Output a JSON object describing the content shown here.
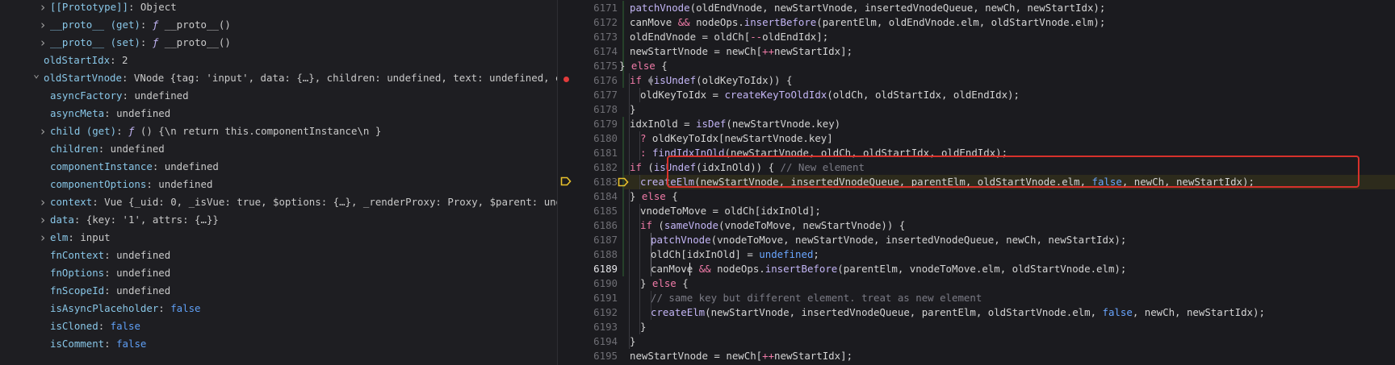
{
  "scope_panel": {
    "rows": [
      {
        "twisty": "right",
        "key": "[[Prototype]]",
        "sep": ": ",
        "value": "Object"
      },
      {
        "twisty": "right",
        "key": "__proto__ (get)",
        "sep": ": ",
        "value_f": "ƒ",
        "value": "__proto__()"
      },
      {
        "twisty": "right",
        "key": "__proto__ (set)",
        "sep": ": ",
        "value_f": "ƒ",
        "value": "__proto__()"
      },
      {
        "twisty": "none",
        "key": "oldStartIdx",
        "sep": ": ",
        "value": "2"
      },
      {
        "twisty": "down",
        "key": "oldStartVnode",
        "sep": ": ",
        "value": "VNode {tag: 'input', data: {…}, children: undefined, text: undefined, elm: input…"
      },
      {
        "twisty": "none",
        "key": "asyncFactory",
        "sep": ": ",
        "value": "undefined"
      },
      {
        "twisty": "none",
        "key": "asyncMeta",
        "sep": ": ",
        "value": "undefined"
      },
      {
        "twisty": "right",
        "key": "child (get)",
        "sep": ": ",
        "value_f": "ƒ",
        "value": "() {\\n    return this.componentInstance\\n  }"
      },
      {
        "twisty": "none",
        "key": "children",
        "sep": ": ",
        "value": "undefined"
      },
      {
        "twisty": "none",
        "key": "componentInstance",
        "sep": ": ",
        "value": "undefined"
      },
      {
        "twisty": "none",
        "key": "componentOptions",
        "sep": ": ",
        "value": "undefined"
      },
      {
        "twisty": "right",
        "key": "context",
        "sep": ": ",
        "value": "Vue {_uid: 0, _isVue: true, $options: {…}, _renderProxy: Proxy, $parent: undefined, …"
      },
      {
        "twisty": "right",
        "key": "data",
        "sep": ": ",
        "value": "{key: '1', attrs: {…}}"
      },
      {
        "twisty": "right",
        "key": "elm",
        "sep": ": ",
        "value": "input"
      },
      {
        "twisty": "none",
        "key": "fnContext",
        "sep": ": ",
        "value": "undefined"
      },
      {
        "twisty": "none",
        "key": "fnOptions",
        "sep": ": ",
        "value": "undefined"
      },
      {
        "twisty": "none",
        "key": "fnScopeId",
        "sep": ": ",
        "value": "undefined"
      },
      {
        "twisty": "none",
        "key": "isAsyncPlaceholder",
        "sep": ": ",
        "value": "false"
      },
      {
        "twisty": "none",
        "key": "isCloned",
        "sep": ": ",
        "value": "false"
      },
      {
        "twisty": "none",
        "key": "isComment",
        "sep": ": ",
        "value": "false"
      }
    ]
  },
  "editor": {
    "current_line": "6189",
    "line_numbers": [
      "6171",
      "6172",
      "6173",
      "6174",
      "6175",
      "6176",
      "6177",
      "6178",
      "6179",
      "6180",
      "6181",
      "6182",
      "6183",
      "6184",
      "6185",
      "6186",
      "6187",
      "6188",
      "6189",
      "6190",
      "6191",
      "6192",
      "6193",
      "6194",
      "6195"
    ],
    "lines": [
      "patchVnode(oldEndVnode, newStartVnode, insertedVnodeQueue, newCh, newStartIdx);",
      "canMove && nodeOps.insertBefore(parentElm, oldEndVnode.elm, oldStartVnode.elm);",
      "oldEndVnode = oldCh[--oldEndIdx];",
      "newStartVnode = newCh[++newStartIdx];",
      "} else {",
      "if (isUndef(oldKeyToIdx)) {",
      "oldKeyToIdx = createKeyToOldIdx(oldCh, oldStartIdx, oldEndIdx);",
      "}",
      "idxInOld = isDef(newStartVnode.key)",
      "? oldKeyToIdx[newStartVnode.key]",
      ": findIdxInOld(newStartVnode, oldCh, oldStartIdx, oldEndIdx);",
      "if (isUndef(idxInOld)) { // New element",
      "createElm(newStartVnode, insertedVnodeQueue, parentElm, oldStartVnode.elm, false, newCh, newStartIdx);",
      "} else {",
      "vnodeToMove = oldCh[idxInOld];",
      "if (sameVnode(vnodeToMove, newStartVnode)) {",
      "patchVnode(vnodeToMove, newStartVnode, insertedVnodeQueue, newCh, newStartIdx);",
      "oldCh[idxInOld] = undefined;",
      "canMove && nodeOps.insertBefore(parentElm, vnodeToMove.elm, oldStartVnode.elm);",
      "} else {",
      "// same key but different element. treat as new element",
      "createElm(newStartVnode, insertedVnodeQueue, parentElm, oldStartVnode.elm, false, newCh, newStartIdx);",
      "}",
      "}",
      "newStartVnode = newCh[++newStartIdx];"
    ]
  },
  "colors": {
    "highlight_border": "#d7312b",
    "breakpoint": "#e23b3b",
    "paused_marker": "#e8c12b"
  }
}
